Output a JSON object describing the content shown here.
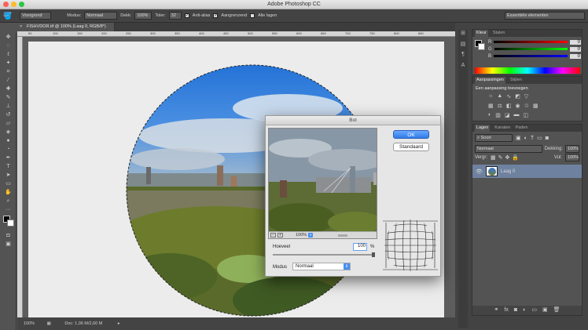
{
  "app": {
    "title": "Adobe Photoshop CC",
    "workspace": "Essentiële elementen"
  },
  "options": {
    "tool_preset": "Voorgrond",
    "mode_label": "Modus:",
    "mode_value": "Normaal",
    "opacity_label": "Dekk:",
    "opacity_value": "100%",
    "tolerance_label": "Toler:",
    "tolerance_value": "32",
    "antialias_label": "Anti-alias",
    "contiguous_label": "Aangrenzend",
    "all_layers_label": "Alle lagen"
  },
  "document": {
    "tab_title": "FISHVDOR.tif @ 100% (Laag 0, RGB/8*)",
    "ruler_marks": [
      "50",
      "100",
      "150",
      "200",
      "250",
      "300",
      "350",
      "400",
      "450",
      "500",
      "550",
      "600",
      "650",
      "700",
      "750",
      "800",
      "850"
    ]
  },
  "status": {
    "zoom": "100%",
    "doc_size": "Doc: 1,06 M/2,60 M"
  },
  "dialog": {
    "title": "Bol",
    "ok_label": "OK",
    "reset_label": "Standaard",
    "zoom": "100%",
    "amount_label": "Hoeveel",
    "amount_value": "100",
    "amount_unit": "%",
    "amount_level": 1.0,
    "mode_label": "Modus",
    "mode_value": "Normaal"
  },
  "color_panel": {
    "tabs": [
      "Kleur",
      "Stalen"
    ],
    "channels": [
      {
        "name": "R",
        "value": "0"
      },
      {
        "name": "G",
        "value": "0"
      },
      {
        "name": "B",
        "value": "0"
      }
    ]
  },
  "adjustments_panel": {
    "tabs": [
      "Aanpassingen",
      "Stijlen"
    ],
    "subtitle": "Een aanpassing toevoegen"
  },
  "layers_panel": {
    "tabs": [
      "Lagen",
      "Kanalen",
      "Paden"
    ],
    "filter": "Soort",
    "blend_mode": "Normaal",
    "opacity_label": "Dekking:",
    "opacity_value": "100%",
    "lock_label": "Vergr:",
    "fill_label": "Vul:",
    "fill_value": "100%",
    "layers": [
      {
        "name": "Laag 0"
      }
    ]
  },
  "colors": {
    "accent": "#4a8ef0",
    "panel": "#535353",
    "canvas": "#ececec"
  }
}
